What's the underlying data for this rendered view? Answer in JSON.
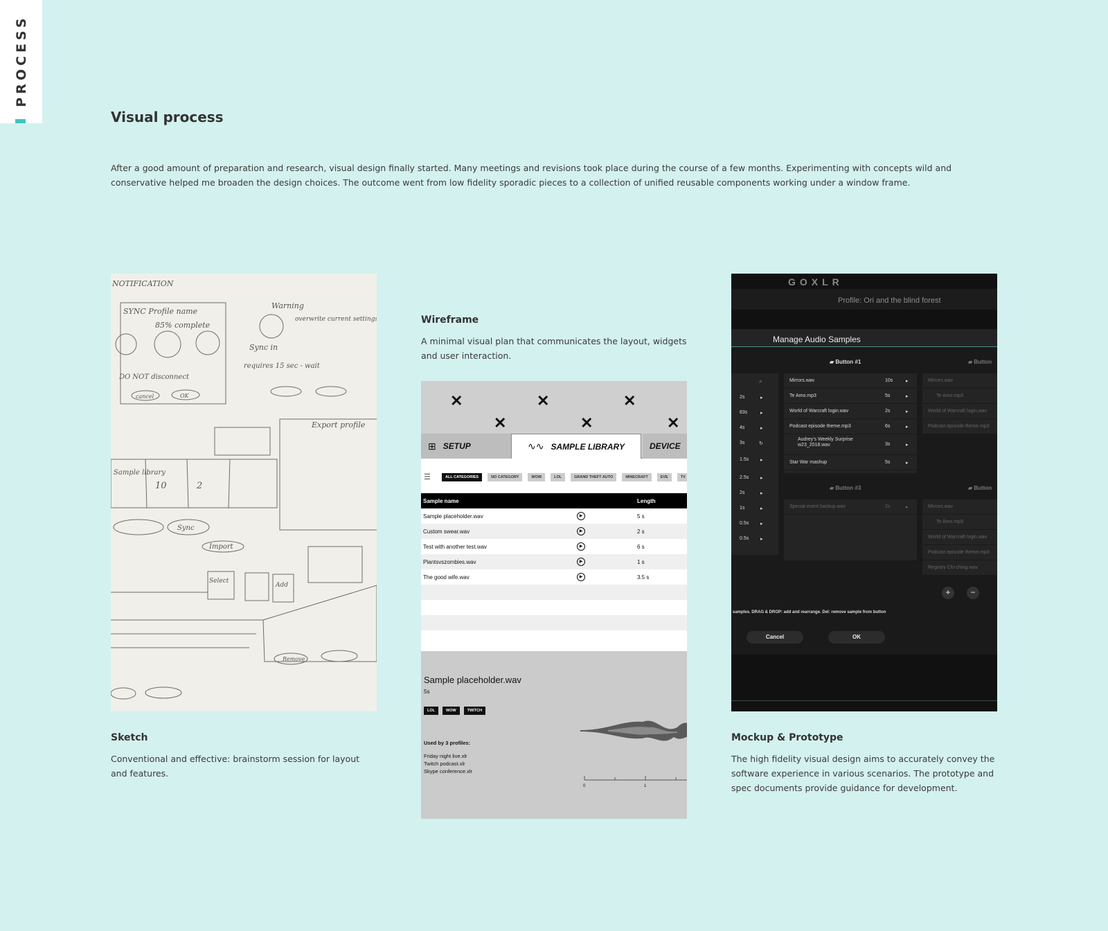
{
  "side_tab": {
    "label": "PROCESS"
  },
  "section": {
    "title": "Visual process",
    "intro": "After a good amount of preparation and research, visual design finally started. Many meetings and revisions took place during the course of a few months. Experimenting with concepts wild and conservative helped me broaden the design choices. The outcome went from low fidelity sporadic pieces to a collection of unified reusable components working under a window frame."
  },
  "cards": {
    "sketch": {
      "title": "Sketch",
      "text": "Conventional and effective: brainstorm session for layout and features."
    },
    "wireframe": {
      "title": "Wireframe",
      "text": "A minimal visual plan that communicates the layout, widgets and user interaction."
    },
    "mockup": {
      "title": "Mockup & Prototype",
      "text": "The high fidelity visual design aims to accurately convey the software experience in various scenarios. The prototype and spec documents provide guidance for development."
    }
  },
  "sketch_image": {
    "notes": [
      "NOTIFICATION",
      "SYNC Profile name",
      "85% complete",
      "Warning",
      "overwrite current settings?",
      "Sync in",
      "requires 15 sec - wait",
      "DO NOT disconnect",
      "cancel",
      "OK",
      "Export profile",
      "Sample library",
      "10",
      "2",
      "Sync",
      "Import",
      "Select",
      "Add",
      "Remove"
    ]
  },
  "wireframe_image": {
    "tabs": {
      "setup": "SETUP",
      "library": "SAMPLE LIBRARY",
      "device": "DEVICE"
    },
    "categories": [
      "ALL CATEGORIES",
      "NO CATEGORY",
      "WOW",
      "LOL",
      "GRAND THEFT AUTO",
      "MINECRAFT",
      "EVE",
      "TV"
    ],
    "columns": {
      "name": "Sample name",
      "length": "Length"
    },
    "rows": [
      {
        "name": "Sample placeholder.wav",
        "length": "5 s"
      },
      {
        "name": "Custom swear.wav",
        "length": "2 s"
      },
      {
        "name": "Test with another test.wav",
        "length": "6 s"
      },
      {
        "name": "Plantsvszombies.wav",
        "length": "1 s"
      },
      {
        "name": "The good wife.wav",
        "length": "3.5 s"
      }
    ],
    "detail": {
      "title": "Sample placeholder.wav",
      "length": "5s",
      "tags": [
        "LOL",
        "WOW",
        "TWITCH"
      ],
      "used_by": "Used by 3 profiles:",
      "profiles": [
        "Friday night live.xlr",
        "Twitch podcast.xlr",
        "Skype conference.xlr"
      ],
      "axis_ticks": [
        "0",
        "1"
      ]
    }
  },
  "mockup_image": {
    "logo": "GOXLR",
    "profile": "Profile: Ori and the blind forest",
    "dialog_title": "Manage Audio Samples",
    "lengths": [
      "2s",
      "83s",
      "4s",
      "3s",
      "1.5s",
      "2.5s",
      "2s",
      "1s",
      "0.5s",
      "0.5s"
    ],
    "button1": {
      "label": "Button #1",
      "rows": [
        {
          "name": "Mirrors.wav",
          "len": "10s"
        },
        {
          "name": "Te Amo.mp3",
          "len": "5s"
        },
        {
          "name": "World of Warcraft login.wav",
          "len": "2s"
        },
        {
          "name": "Podcast episode theme.mp3",
          "len": "6s"
        },
        {
          "name": "Audrey's Weekly Surprise w23_2018.wav",
          "len": "3s"
        },
        {
          "name": "Star War mashup",
          "len": "5s"
        }
      ]
    },
    "button2": {
      "label": "Button",
      "rows": [
        "Mirrors.wav",
        "Te Amo.mp3",
        "World of Warcraft login.wav",
        "Podcast episode theme.mp3"
      ]
    },
    "button3": {
      "label": "Button #3",
      "rows": [
        {
          "name": "Special event backup.wav",
          "len": "2s"
        }
      ]
    },
    "button4": {
      "label": "Button",
      "rows": [
        "Mirrors.wav",
        "Te Amo.mp3",
        "World of Warcraft login.wav",
        "Podcast episode theme.mp3",
        "Registry Chi-ching.wav"
      ]
    },
    "help": "samples.   DRAG & DROP: add and rearrange.   Del: remove sample from button",
    "cancel": "Cancel",
    "ok": "OK",
    "plus": "+",
    "minus": "−"
  }
}
